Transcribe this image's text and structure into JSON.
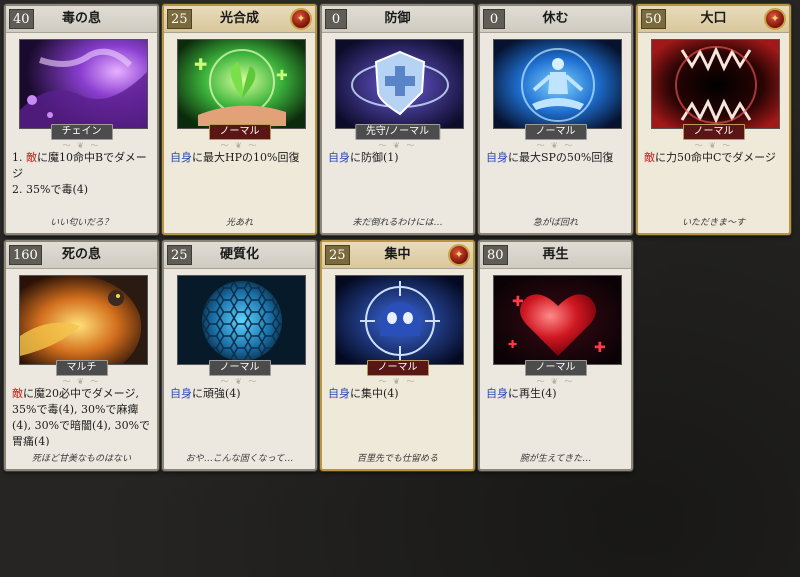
{
  "cards": [
    {
      "cost": "40",
      "title": "毒の息",
      "tag": "チェイン",
      "target": "敵",
      "lines": [
        "1. 敵に魔10命中Bでダメージ",
        "2. 35%で毒(4)"
      ],
      "desc_rest": "に魔10命中Bでダメージ",
      "flavor": "いい匂いだろ？",
      "emblem": ""
    },
    {
      "cost": "25",
      "title": "光合成",
      "tag": "ノーマル",
      "target": "自身",
      "desc_rest": "に最大HPの10%回復",
      "flavor": "光あれ",
      "emblem": "✦"
    },
    {
      "cost": "0",
      "title": "防御",
      "tag": "先守/ノーマル",
      "target": "自身",
      "desc_rest": "に防御(1)",
      "flavor": "未だ倒れるわけには…",
      "emblem": ""
    },
    {
      "cost": "0",
      "title": "休む",
      "tag": "ノーマル",
      "target": "自身",
      "desc_rest": "に最大SPの50%回復",
      "flavor": "急がば回れ",
      "emblem": ""
    },
    {
      "cost": "50",
      "title": "大口",
      "tag": "ノーマル",
      "target": "敵",
      "desc_rest": "に力50命中Cでダメージ",
      "flavor": "いただきま～す",
      "emblem": "✦"
    },
    {
      "cost": "160",
      "title": "死の息",
      "tag": "マルチ",
      "target": "敵",
      "desc_rest": "に魔20必中でダメージ, 35%で毒(4), 30%で麻痺(4), 30%で暗闇(4), 30%で胃痛(4)",
      "flavor": "死ほど甘美なものはない",
      "emblem": ""
    },
    {
      "cost": "25",
      "title": "硬質化",
      "tag": "ノーマル",
      "target": "自身",
      "desc_rest": "に頑強(4)",
      "flavor": "おや…こんな固くなって…",
      "emblem": ""
    },
    {
      "cost": "25",
      "title": "集中",
      "tag": "ノーマル",
      "target": "自身",
      "desc_rest": "に集中(4)",
      "flavor": "百里先でも仕留める",
      "emblem": "✦"
    },
    {
      "cost": "80",
      "title": "再生",
      "tag": "ノーマル",
      "target": "自身",
      "desc_rest": "に再生(4)",
      "flavor": "腕が生えてきた…",
      "emblem": ""
    }
  ],
  "first_card": {
    "line1_num": "1. ",
    "line1_target": "敵",
    "line1_rest": "に魔10命中Bでダメージ",
    "line2": "2. 35%で毒(4)"
  },
  "divider": "～ ❦ ～",
  "colors": {
    "self_target": "#2848b8",
    "enemy_target": "#c0231a",
    "gold_border": "#b8963e",
    "silver_border": "#8b8678"
  }
}
